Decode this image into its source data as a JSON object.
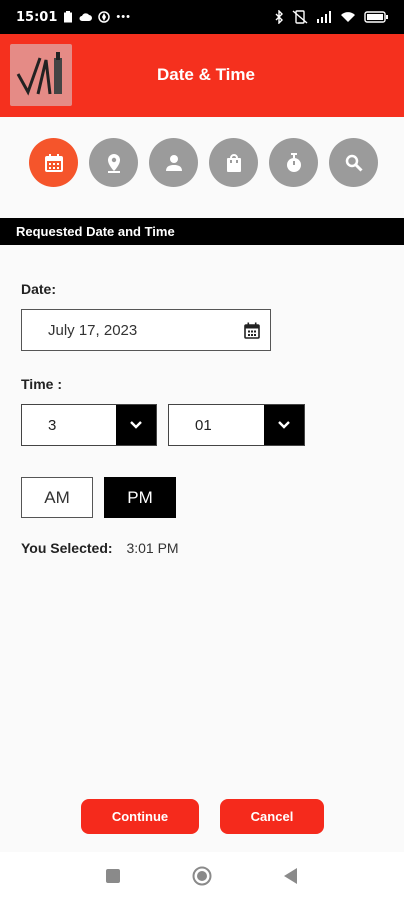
{
  "status_bar": {
    "time": "15:01",
    "more": "•••"
  },
  "app_bar": {
    "title": "Date & Time"
  },
  "steps": [
    {
      "icon": "calendar-icon",
      "active": true
    },
    {
      "icon": "location-pin-icon",
      "active": false
    },
    {
      "icon": "person-icon",
      "active": false
    },
    {
      "icon": "shopping-bag-icon",
      "active": false
    },
    {
      "icon": "stopwatch-icon",
      "active": false
    },
    {
      "icon": "search-icon",
      "active": false
    }
  ],
  "section": {
    "title": "Requested Date and Time"
  },
  "form": {
    "date_label": "Date:",
    "date_value": "July 17, 2023",
    "time_label": "Time :",
    "hour_value": "3",
    "minute_value": "01",
    "am_label": "AM",
    "pm_label": "PM",
    "selected_period": "PM",
    "you_selected_label": "You Selected:",
    "you_selected_value": "3:01 PM"
  },
  "actions": {
    "continue_label": "Continue",
    "cancel_label": "Cancel"
  },
  "colors": {
    "brand_red": "#f5301e",
    "active_step": "#f5552b",
    "inactive_step": "#9b9b9b"
  }
}
